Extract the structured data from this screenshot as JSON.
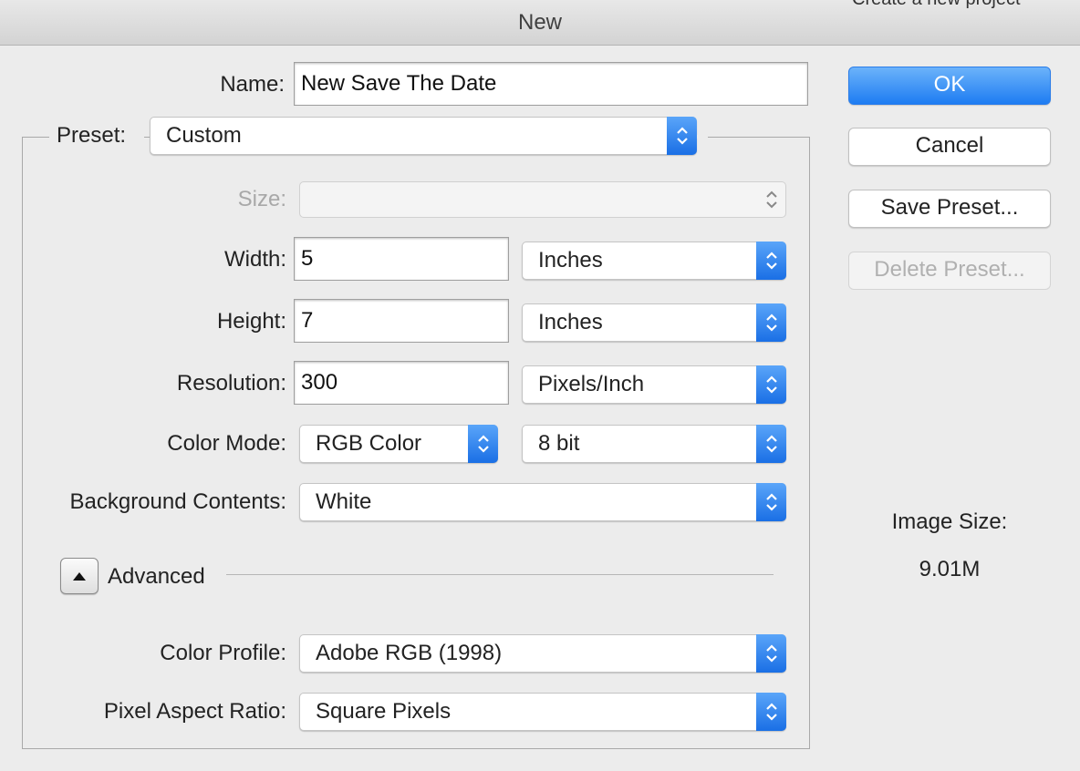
{
  "window": {
    "title": "New",
    "behind_text": "Create a new project"
  },
  "name": {
    "label": "Name:",
    "value": "New Save The Date"
  },
  "preset": {
    "label": "Preset:",
    "value": "Custom"
  },
  "size": {
    "label": "Size:",
    "value": ""
  },
  "width": {
    "label": "Width:",
    "value": "5",
    "unit": "Inches"
  },
  "height": {
    "label": "Height:",
    "value": "7",
    "unit": "Inches"
  },
  "resolution": {
    "label": "Resolution:",
    "value": "300",
    "unit": "Pixels/Inch"
  },
  "color_mode": {
    "label": "Color Mode:",
    "value": "RGB Color",
    "depth": "8 bit"
  },
  "background": {
    "label": "Background Contents:",
    "value": "White"
  },
  "advanced": {
    "label": "Advanced",
    "expanded": true
  },
  "color_profile": {
    "label": "Color Profile:",
    "value": "Adobe RGB (1998)"
  },
  "pixel_aspect": {
    "label": "Pixel Aspect Ratio:",
    "value": "Square Pixels"
  },
  "buttons": {
    "ok": "OK",
    "cancel": "Cancel",
    "save_preset": "Save Preset...",
    "delete_preset": "Delete Preset..."
  },
  "image_size": {
    "label": "Image Size:",
    "value": "9.01M"
  },
  "colors": {
    "accent": "#1d7cf2",
    "background": "#ececec"
  }
}
